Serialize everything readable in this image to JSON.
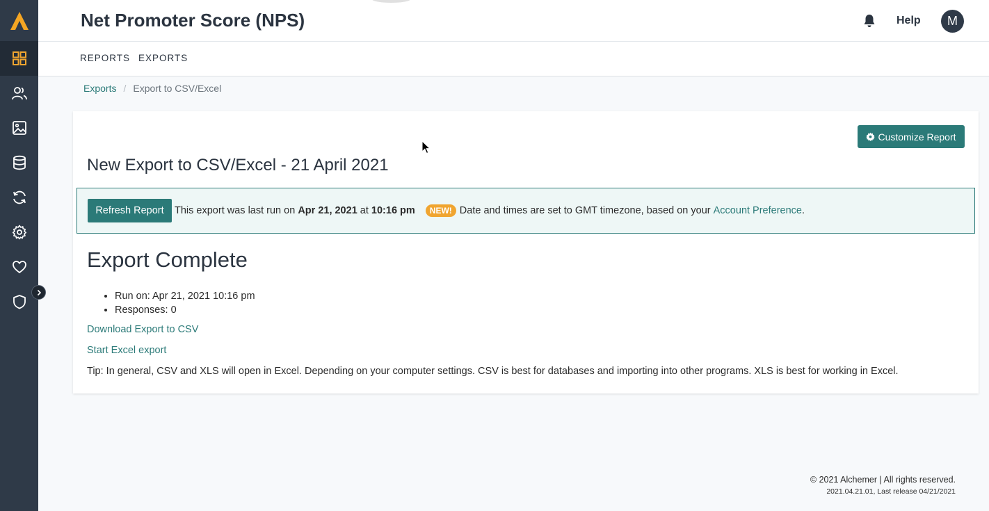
{
  "app": {
    "page_title": "Net Promoter Score (NPS)",
    "help_label": "Help",
    "avatar_initial": "M"
  },
  "sidebar": {
    "items": [
      {
        "name": "dashboard-icon"
      },
      {
        "name": "users-icon"
      },
      {
        "name": "image-icon"
      },
      {
        "name": "database-icon"
      },
      {
        "name": "sync-icon"
      },
      {
        "name": "gear-icon"
      },
      {
        "name": "heart-icon"
      },
      {
        "name": "shield-icon"
      }
    ]
  },
  "subnav": {
    "reports_label": "REPORTS",
    "exports_label": "EXPORTS"
  },
  "breadcrumb": {
    "parent": "Exports",
    "separator": "/",
    "current": "Export to CSV/Excel"
  },
  "card": {
    "customize_label": "Customize Report",
    "title": "New Export to CSV/Excel - 21 April 2021",
    "refresh_label": "Refresh Report",
    "info_prefix": "This export was last run on",
    "info_date": "Apr 21, 2021",
    "info_at": "at",
    "info_time": "10:16 pm",
    "new_badge": "NEW!",
    "info_timezone": "Date and times are set to GMT timezone, based on your",
    "account_pref_link": "Account Preference",
    "period": ".",
    "complete_heading": "Export Complete",
    "run_on": "Run on: Apr 21, 2021 10:16 pm",
    "responses": "Responses: 0",
    "download_csv": "Download Export to CSV",
    "start_excel": "Start Excel export",
    "tip": "Tip: In general, CSV and XLS will open in Excel. Depending on your computer settings. CSV is best for databases and importing into other programs. XLS is best for working in Excel."
  },
  "footer": {
    "copyright": "© 2021 Alchemer | All rights reserved.",
    "version": "2021.04.21.01, Last release 04/21/2021"
  },
  "colors": {
    "accent": "#2b7a78",
    "sidebar": "#2f3a48",
    "badge": "#f0a530",
    "logo": "#f5a623"
  }
}
